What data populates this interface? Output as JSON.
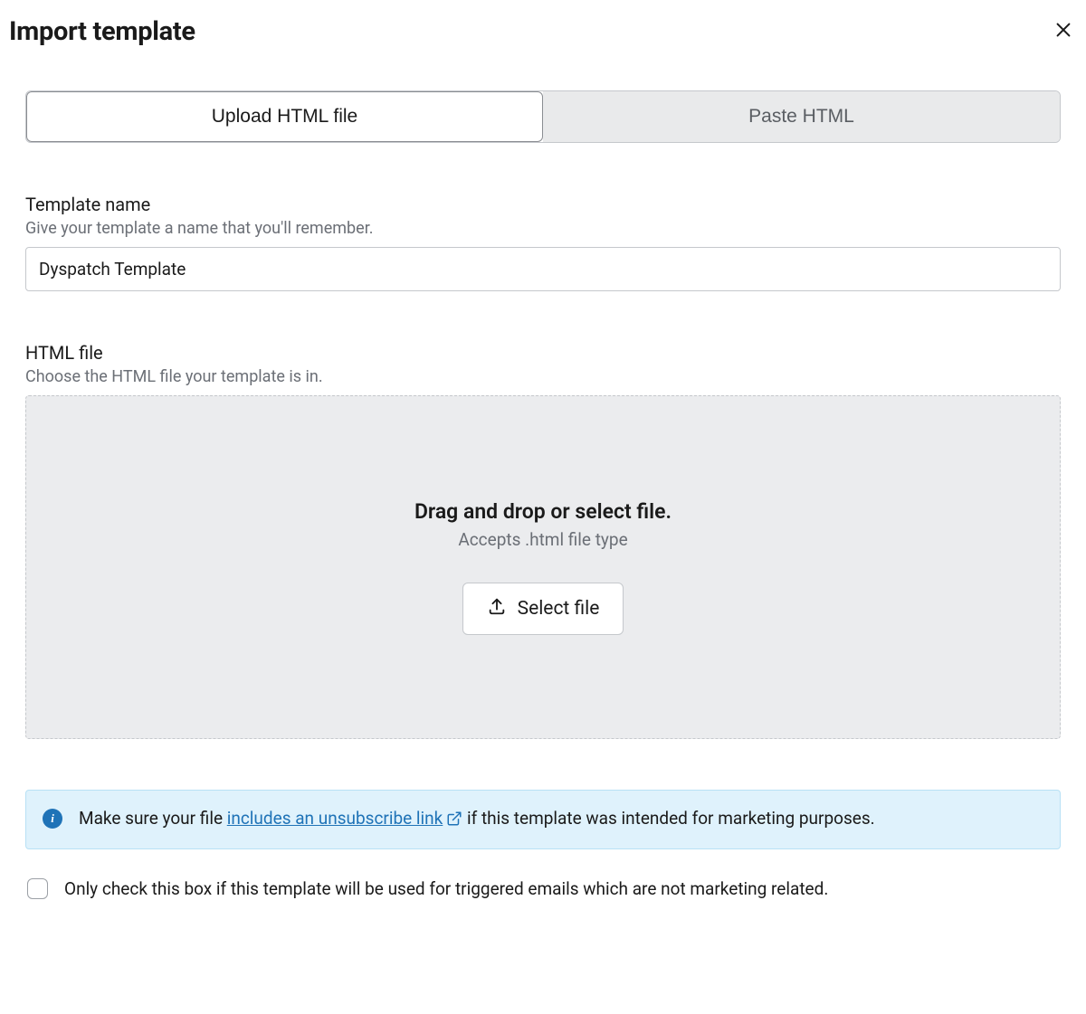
{
  "header": {
    "title": "Import template"
  },
  "tabs": {
    "upload": "Upload HTML file",
    "paste": "Paste HTML"
  },
  "template_name": {
    "label": "Template name",
    "hint": "Give your template a name that you'll remember.",
    "value": "Dyspatch Template"
  },
  "html_file": {
    "label": "HTML file",
    "hint": "Choose the HTML file your template is in.",
    "drop_heading": "Drag and drop or select file.",
    "drop_subtext": "Accepts .html file type",
    "select_button": "Select file"
  },
  "info": {
    "text_before": "Make sure your file ",
    "link_text": "includes an unsubscribe link",
    "text_after": " if this template was intended for marketing purposes."
  },
  "checkbox": {
    "label": "Only check this box if this template will be used for triggered emails which are not marketing related."
  }
}
